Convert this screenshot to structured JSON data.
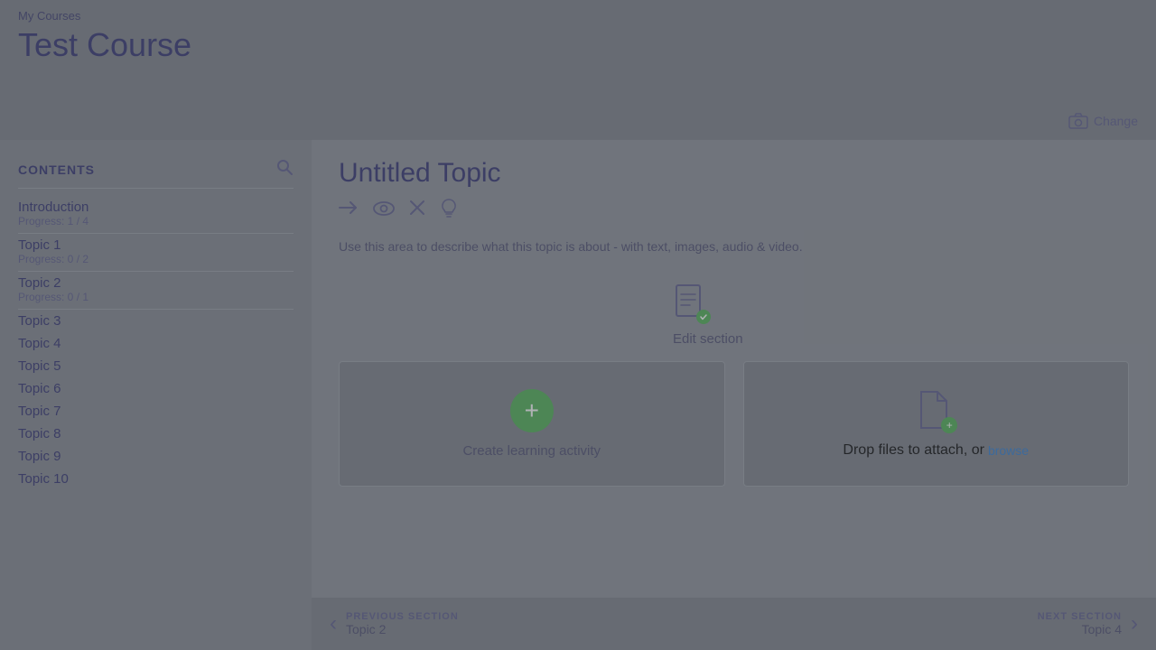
{
  "topbar": {
    "my_courses_label": "My Courses",
    "course_title": "Test Course",
    "change_image_label": "Change"
  },
  "sidebar": {
    "contents_label": "CONTENTS",
    "items": [
      {
        "id": "introduction",
        "title": "Introduction",
        "progress": "Progress: 1 / 4",
        "has_progress": true
      },
      {
        "id": "topic1",
        "title": "Topic 1",
        "progress": "Progress: 0 / 2",
        "has_progress": true
      },
      {
        "id": "topic2",
        "title": "Topic 2",
        "progress": "Progress: 0 / 1",
        "has_progress": true
      },
      {
        "id": "topic3",
        "title": "Topic 3",
        "has_progress": false
      },
      {
        "id": "topic4",
        "title": "Topic 4",
        "has_progress": false
      },
      {
        "id": "topic5",
        "title": "Topic 5",
        "has_progress": false
      },
      {
        "id": "topic6",
        "title": "Topic 6",
        "has_progress": false
      },
      {
        "id": "topic7",
        "title": "Topic 7",
        "has_progress": false
      },
      {
        "id": "topic8",
        "title": "Topic 8",
        "has_progress": false
      },
      {
        "id": "topic9",
        "title": "Topic 9",
        "has_progress": false
      },
      {
        "id": "topic10",
        "title": "Topic 10",
        "has_progress": false
      }
    ]
  },
  "content": {
    "topic_title": "Untitled Topic",
    "topic_description": "Use this area to describe what this topic is about - with text, images, audio & video.",
    "edit_section_label": "Edit section",
    "create_activity_label": "Create learning activity",
    "drop_files_label": "Drop files to attach, or",
    "browse_label": "browse"
  },
  "bottom_nav": {
    "previous_label": "PREVIOUS SECTION",
    "previous_topic": "Topic 2",
    "next_label": "NEXT SECTION",
    "next_topic": "Topic 4"
  }
}
